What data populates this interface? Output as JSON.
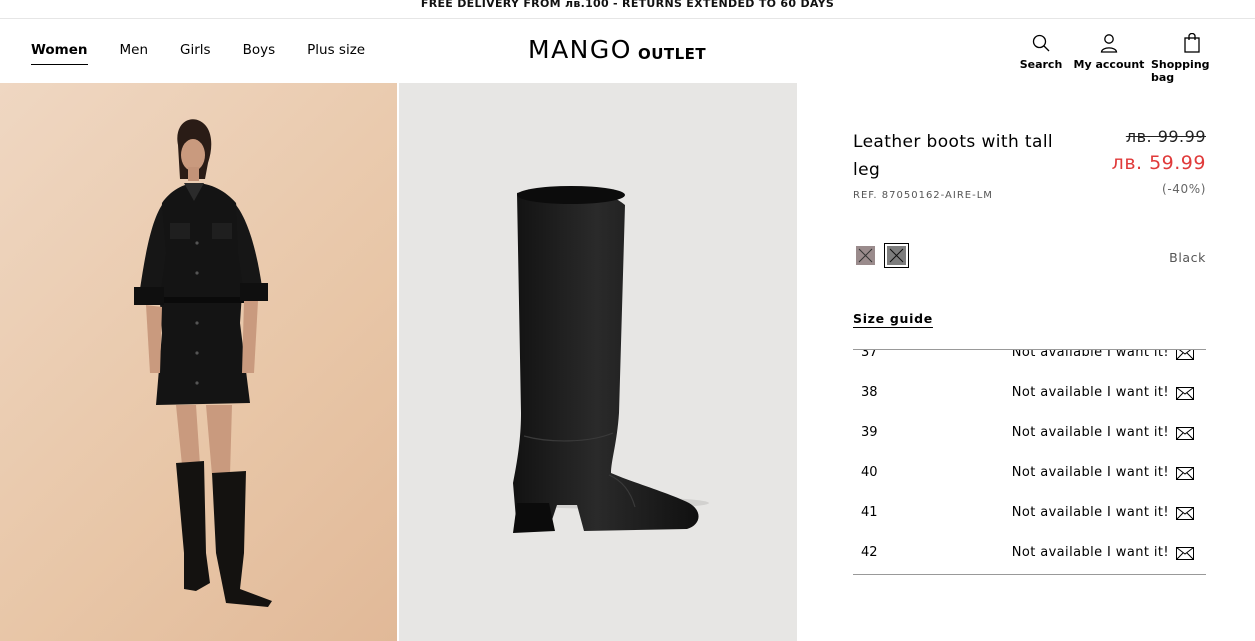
{
  "promo": "FREE DELIVERY FROM лв.100 - RETURNS EXTENDED TO 60 DAYS",
  "nav": {
    "items": [
      "Women",
      "Men",
      "Girls",
      "Boys",
      "Plus size"
    ],
    "active": "Women"
  },
  "logo": {
    "brand": "MANGO",
    "sub": "OUTLET"
  },
  "header_icons": {
    "search": "Search",
    "account": "My account",
    "bag": "Shopping bag"
  },
  "product": {
    "title": "Leather boots with tall leg",
    "old_price": "лв. 99.99",
    "new_price": "лв. 59.99",
    "discount": "(-40%)",
    "ref": "REF. 87050162-AIRE-LM",
    "color_name": "Black",
    "size_guide": "Size guide",
    "accent_color": "#e03a3a",
    "sizes": [
      {
        "size": "37",
        "status": "Not available I want it!"
      },
      {
        "size": "38",
        "status": "Not available I want it!"
      },
      {
        "size": "39",
        "status": "Not available I want it!"
      },
      {
        "size": "40",
        "status": "Not available I want it!"
      },
      {
        "size": "41",
        "status": "Not available I want it!"
      },
      {
        "size": "42",
        "status": "Not available I want it!"
      }
    ]
  }
}
